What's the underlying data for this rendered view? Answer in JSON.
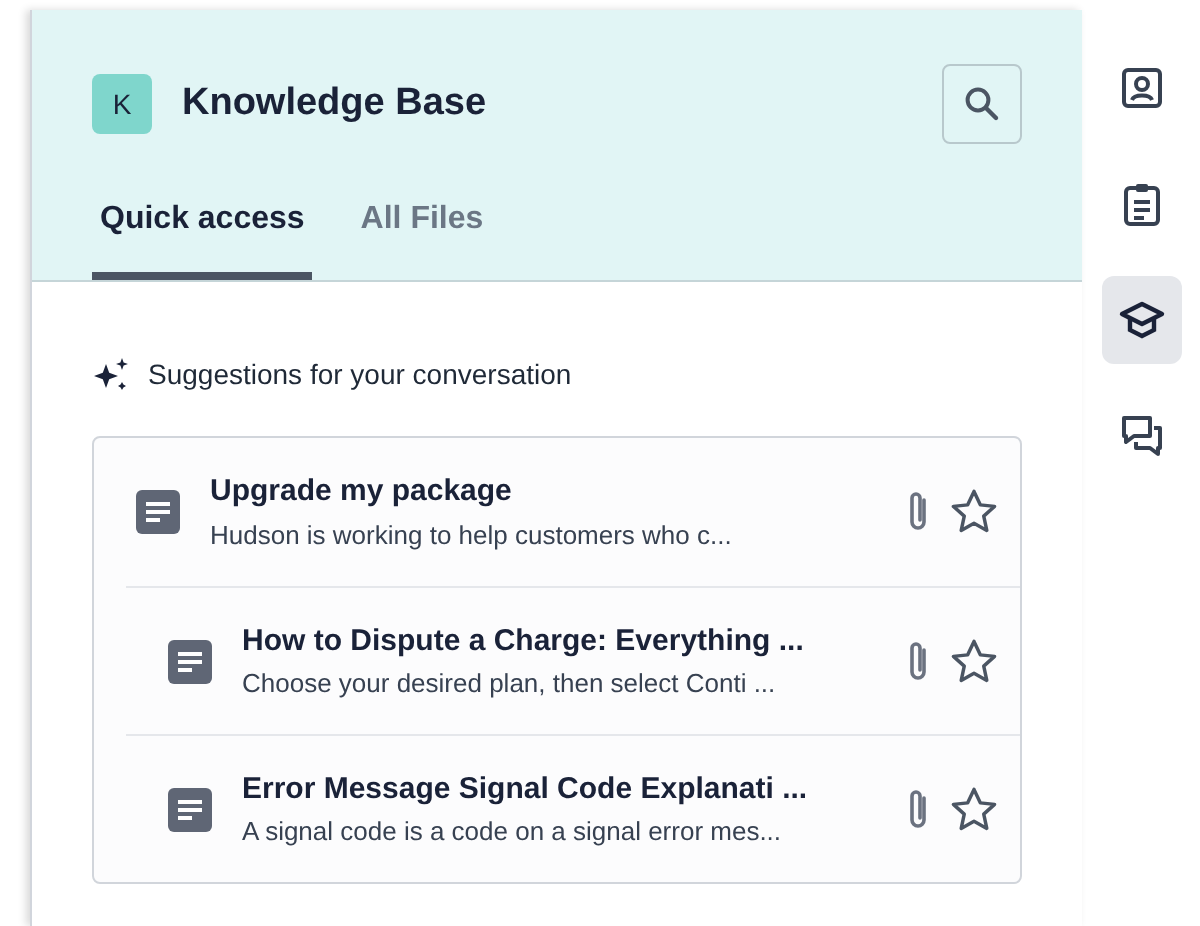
{
  "header": {
    "badge": "K",
    "title": "Knowledge Base"
  },
  "tabs": [
    {
      "label": "Quick access",
      "selected": true
    },
    {
      "label": "All Files",
      "selected": false
    }
  ],
  "suggestions": {
    "heading": "Suggestions for your conversation",
    "items": [
      {
        "title": "Upgrade my package",
        "snippet": "Hudson is working to help customers who c...",
        "starred": false
      },
      {
        "title": "How to Dispute a Charge: Everything ...",
        "snippet": "Choose your desired plan, then select Conti ...",
        "starred": false
      },
      {
        "title": "Error Message Signal Code Explanati ...",
        "snippet": "A signal code is a code on a signal error mes...",
        "starred": false
      }
    ]
  },
  "rail": [
    {
      "kind": "contact",
      "selected": false
    },
    {
      "kind": "clipboard",
      "selected": false
    },
    {
      "kind": "learning",
      "selected": true
    },
    {
      "kind": "chat",
      "selected": false
    }
  ]
}
